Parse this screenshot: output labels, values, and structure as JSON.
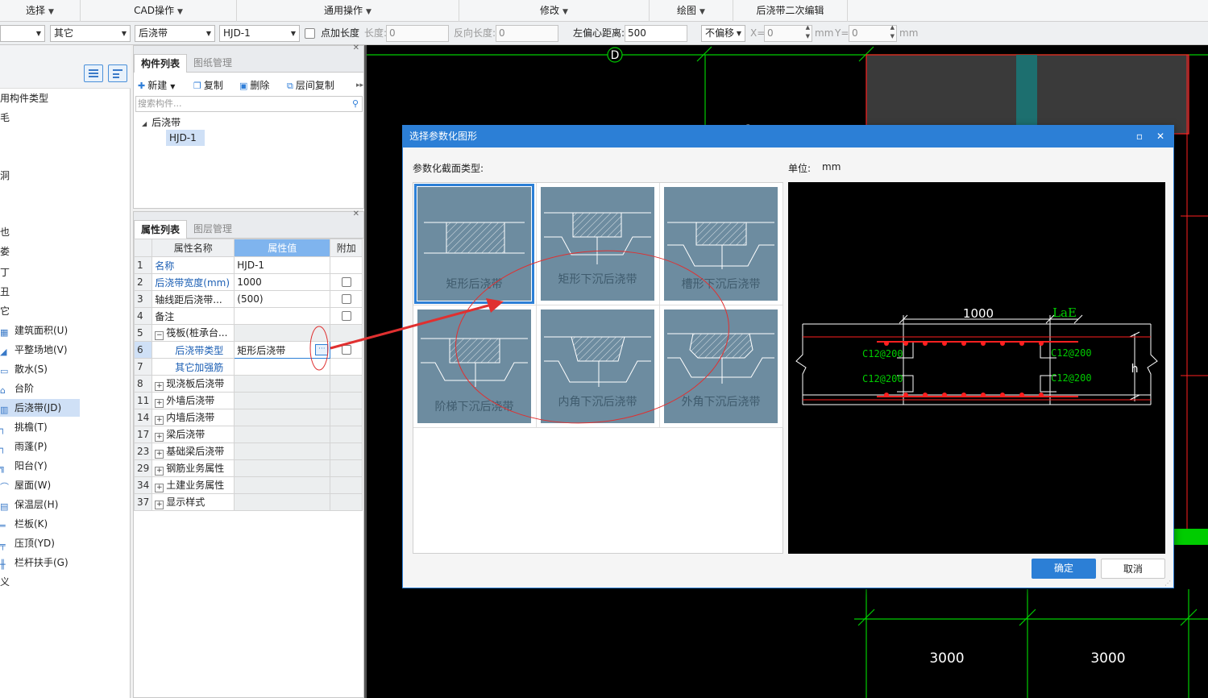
{
  "menubar": {
    "groups": [
      {
        "label": "选择"
      },
      {
        "label": "CAD操作"
      },
      {
        "label": "通用操作"
      },
      {
        "label": "修改"
      },
      {
        "label": "绘图"
      },
      {
        "label": "后浇带二次编辑"
      }
    ]
  },
  "propbar": {
    "combo1": "",
    "combo2": "其它",
    "combo3": "后浇带",
    "combo4": "HJD-1",
    "add_length_label": "点加长度",
    "length_label": "长度:",
    "length_value": "0",
    "reverse_length_label": "反向长度:",
    "reverse_length_value": "0",
    "left_offset_label": "左偏心距离:",
    "left_offset_value": "500",
    "offset_combo": "不偏移",
    "x_label": "X=",
    "x_value": "0",
    "x_unit": "mm",
    "y_label": "Y=",
    "y_value": "0",
    "y_unit": "mm"
  },
  "leftpanel": {
    "items": [
      {
        "label": "用构件类型"
      },
      {
        "label": "毛"
      },
      {
        "label": "洞"
      },
      {
        "label": "也"
      },
      {
        "label": "娄"
      },
      {
        "label": "丁"
      },
      {
        "label": "丑"
      },
      {
        "label": "它"
      },
      {
        "label": "建筑面积(U)"
      },
      {
        "label": "平整场地(V)"
      },
      {
        "label": "散水(S)"
      },
      {
        "label": "台阶"
      },
      {
        "label": "后浇带(JD)"
      },
      {
        "label": "挑檐(T)"
      },
      {
        "label": "雨蓬(P)"
      },
      {
        "label": "阳台(Y)"
      },
      {
        "label": "屋面(W)"
      },
      {
        "label": "保温层(H)"
      },
      {
        "label": "栏板(K)"
      },
      {
        "label": "压顶(YD)"
      },
      {
        "label": "栏杆扶手(G)"
      },
      {
        "label": "义"
      }
    ]
  },
  "comppanel": {
    "tab_active": "构件列表",
    "tab_inactive": "图纸管理",
    "new_label": "新建",
    "copy_label": "复制",
    "delete_label": "删除",
    "floor_copy_label": "层间复制",
    "search_placeholder": "搜索构件...",
    "tree_root": "后浇带",
    "tree_child": "HJD-1"
  },
  "proppanel": {
    "tab_active": "属性列表",
    "tab_inactive": "图层管理",
    "col_name": "属性名称",
    "col_value": "属性值",
    "col_add": "附加",
    "rows": [
      {
        "num": "1",
        "name": "名称",
        "value": "HJD-1"
      },
      {
        "num": "2",
        "name": "后浇带宽度(mm)",
        "value": "1000"
      },
      {
        "num": "3",
        "name": "轴线距后浇带...",
        "value": "(500)"
      },
      {
        "num": "4",
        "name": "备注",
        "value": ""
      },
      {
        "num": "5",
        "name": "筏板(桩承台...",
        "value": ""
      },
      {
        "num": "6",
        "name": "后浇带类型",
        "value": "矩形后浇带"
      },
      {
        "num": "7",
        "name": "其它加强筋",
        "value": ""
      },
      {
        "num": "8",
        "name": "现浇板后浇带",
        "value": ""
      },
      {
        "num": "11",
        "name": "外墙后浇带",
        "value": ""
      },
      {
        "num": "14",
        "name": "内墙后浇带",
        "value": ""
      },
      {
        "num": "17",
        "name": "梁后浇带",
        "value": ""
      },
      {
        "num": "23",
        "name": "基础梁后浇带",
        "value": ""
      },
      {
        "num": "29",
        "name": "钢筋业务属性",
        "value": ""
      },
      {
        "num": "34",
        "name": "土建业务属性",
        "value": ""
      },
      {
        "num": "37",
        "name": "显示样式",
        "value": ""
      }
    ]
  },
  "canvas": {
    "axis_label": "D",
    "dim_left": "3000",
    "dim_right": "3000",
    "side_glyph": "8"
  },
  "dialog": {
    "title": "选择参数化图形",
    "section_label": "参数化截面类型:",
    "unit_label": "单位:",
    "unit_value": "mm",
    "shapes": [
      {
        "label": "矩形后浇带"
      },
      {
        "label": "矩形下沉后浇带"
      },
      {
        "label": "槽形下沉后浇带"
      },
      {
        "label": "阶梯下沉后浇带"
      },
      {
        "label": "内角下沉后浇带"
      },
      {
        "label": "外角下沉后浇带"
      }
    ],
    "preview": {
      "width_dim": "1000",
      "lae_label": "LaE",
      "rebar_tl": "C12@200",
      "rebar_tr": "C12@200",
      "rebar_bl": "C12@200",
      "rebar_br": "C12@200",
      "h_label": "h"
    },
    "ok_label": "确定",
    "cancel_label": "取消"
  },
  "colors": {
    "accent": "#2c7fd6",
    "thumb_bg": "#6d8ca0",
    "cad_green": "#00cc00",
    "cad_red": "#ff2020",
    "annotation_red": "#e03030"
  }
}
